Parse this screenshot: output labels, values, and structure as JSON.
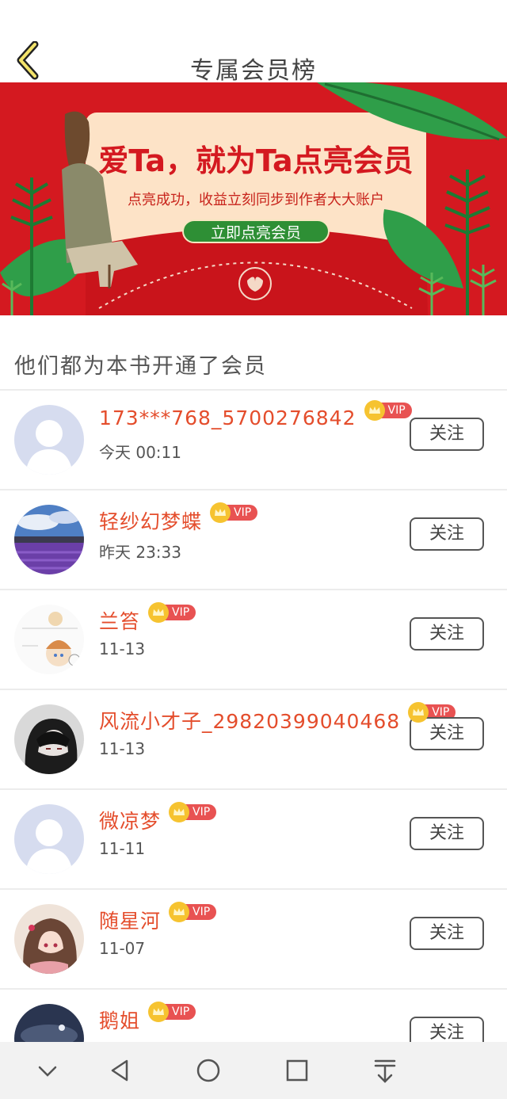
{
  "header": {
    "title": "专属会员榜",
    "back_icon": "chevron-left-icon"
  },
  "banner": {
    "title": "爱Ta，就为Ta点亮会员",
    "subtitle": "点亮成功，收益立刻同步到作者大大账户",
    "button_label": "立即点亮会员",
    "colors": {
      "background": "#d41920",
      "card": "#fde3c7",
      "button": "#2e8f35"
    }
  },
  "section": {
    "title": "他们都为本书开通了会员"
  },
  "members": [
    {
      "name": "173***768_5700276842",
      "badge": "VIP",
      "time": "今天 00:11",
      "follow_label": "关注",
      "avatar": "default-avatar"
    },
    {
      "name": "轻纱幻梦蝶",
      "badge": "VIP",
      "time": "昨天 23:33",
      "follow_label": "关注",
      "avatar": "lavender-field-avatar"
    },
    {
      "name": "兰笞",
      "badge": "VIP",
      "time": "11-13",
      "follow_label": "关注",
      "avatar": "anime-sketch-avatar"
    },
    {
      "name": "风流小才子_29820399040468",
      "badge": "VIP",
      "time": "11-13",
      "follow_label": "关注",
      "avatar": "hooded-anime-avatar"
    },
    {
      "name": "微凉梦",
      "badge": "VIP",
      "time": "11-11",
      "follow_label": "关注",
      "avatar": "default-avatar"
    },
    {
      "name": "随星河",
      "badge": "VIP",
      "time": "11-07",
      "follow_label": "关注",
      "avatar": "anime-girl-avatar"
    },
    {
      "name": "鹅姐",
      "badge": "VIP",
      "time": "",
      "follow_label": "关注",
      "avatar": "night-sky-avatar"
    }
  ],
  "navbar": [
    "chevron-down-icon",
    "back-triangle-icon",
    "home-circle-icon",
    "recents-square-icon",
    "download-icon"
  ],
  "colors": {
    "username": "#e44d2c",
    "vip_badge": "#e85252",
    "crown": "#f6c330"
  }
}
